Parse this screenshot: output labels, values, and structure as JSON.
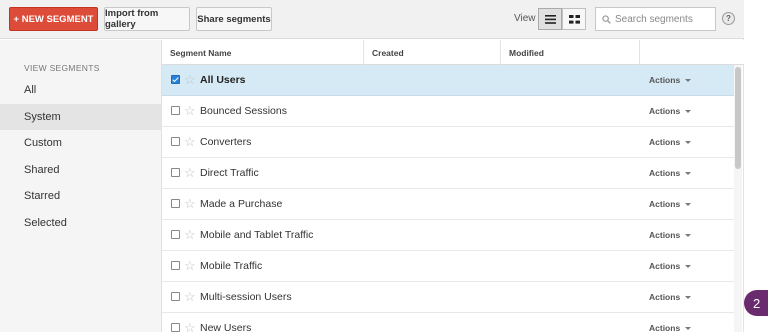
{
  "toolbar": {
    "new_segment_label": "+ NEW SEGMENT",
    "import_label": "Import from gallery",
    "share_label": "Share segments",
    "view_label": "View",
    "view_list_icon": "list-view-icon",
    "view_grid_icon": "grid-view-icon",
    "search_placeholder": "Search segments",
    "help_label": "?"
  },
  "sidebar": {
    "heading": "VIEW SEGMENTS",
    "items": [
      {
        "label": "All"
      },
      {
        "label": "System",
        "active": true
      },
      {
        "label": "Custom"
      },
      {
        "label": "Shared"
      },
      {
        "label": "Starred"
      },
      {
        "label": "Selected"
      }
    ]
  },
  "table": {
    "columns": [
      "Segment Name",
      "Created",
      "Modified",
      ""
    ],
    "rows": [
      {
        "name": "All Users",
        "checked": true,
        "actions": "Actions"
      },
      {
        "name": "Bounced Sessions",
        "checked": false,
        "actions": "Actions"
      },
      {
        "name": "Converters",
        "checked": false,
        "actions": "Actions"
      },
      {
        "name": "Direct Traffic",
        "checked": false,
        "actions": "Actions"
      },
      {
        "name": "Made a Purchase",
        "checked": false,
        "actions": "Actions"
      },
      {
        "name": "Mobile and Tablet Traffic",
        "checked": false,
        "actions": "Actions"
      },
      {
        "name": "Mobile Traffic",
        "checked": false,
        "actions": "Actions"
      },
      {
        "name": "Multi-session Users",
        "checked": false,
        "actions": "Actions"
      },
      {
        "name": "New Users",
        "checked": false,
        "actions": "Actions"
      }
    ]
  },
  "badge": {
    "count": "2"
  },
  "colors": {
    "accent": "#dd4b39",
    "selected_row": "#d6eaf6",
    "checkbox": "#2a82d6",
    "badge": "#6a2a6e"
  }
}
